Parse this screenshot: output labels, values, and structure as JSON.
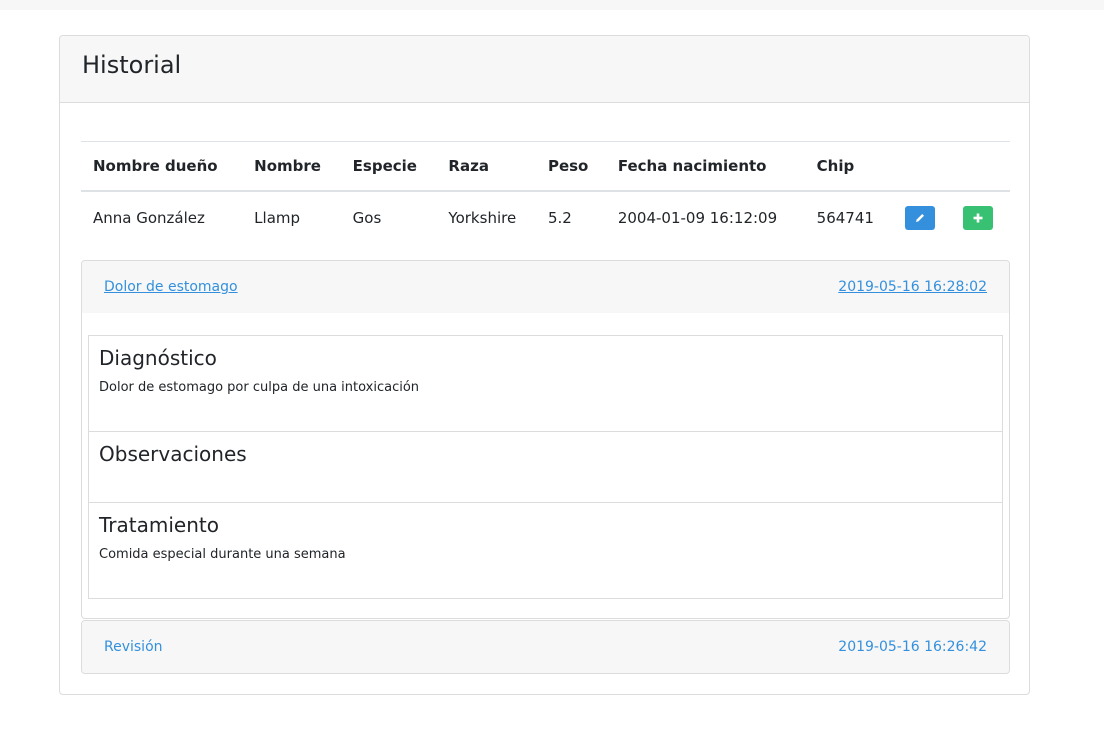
{
  "card": {
    "title": "Historial"
  },
  "table": {
    "headers": [
      "Nombre dueño",
      "Nombre",
      "Especie",
      "Raza",
      "Peso",
      "Fecha nacimiento",
      "Chip"
    ],
    "rows": [
      {
        "owner": "Anna González",
        "name": "Llamp",
        "species": "Gos",
        "breed": "Yorkshire",
        "weight": "5.2",
        "birth_date": "2004-01-09 16:12:09",
        "chip": "564741"
      }
    ]
  },
  "history": [
    {
      "reason": "Dolor de estomago",
      "date": "2019-05-16 16:28:02",
      "diagnosis_title": "Diagnóstico",
      "diagnosis_text": "Dolor de estomago por culpa de una intoxicación",
      "observations_title": "Observaciones",
      "observations_text": "",
      "treatment_title": "Tratamiento",
      "treatment_text": "Comida especial durante una semana"
    },
    {
      "reason": "Revisión",
      "date": "2019-05-16 16:26:42"
    }
  ],
  "colors": {
    "primary": "#3490dc",
    "success": "#38c172",
    "header_bg": "#f7f7f7",
    "border": "#dcdcdc"
  },
  "icons": {
    "edit": "pencil-icon",
    "add": "plus-icon"
  }
}
